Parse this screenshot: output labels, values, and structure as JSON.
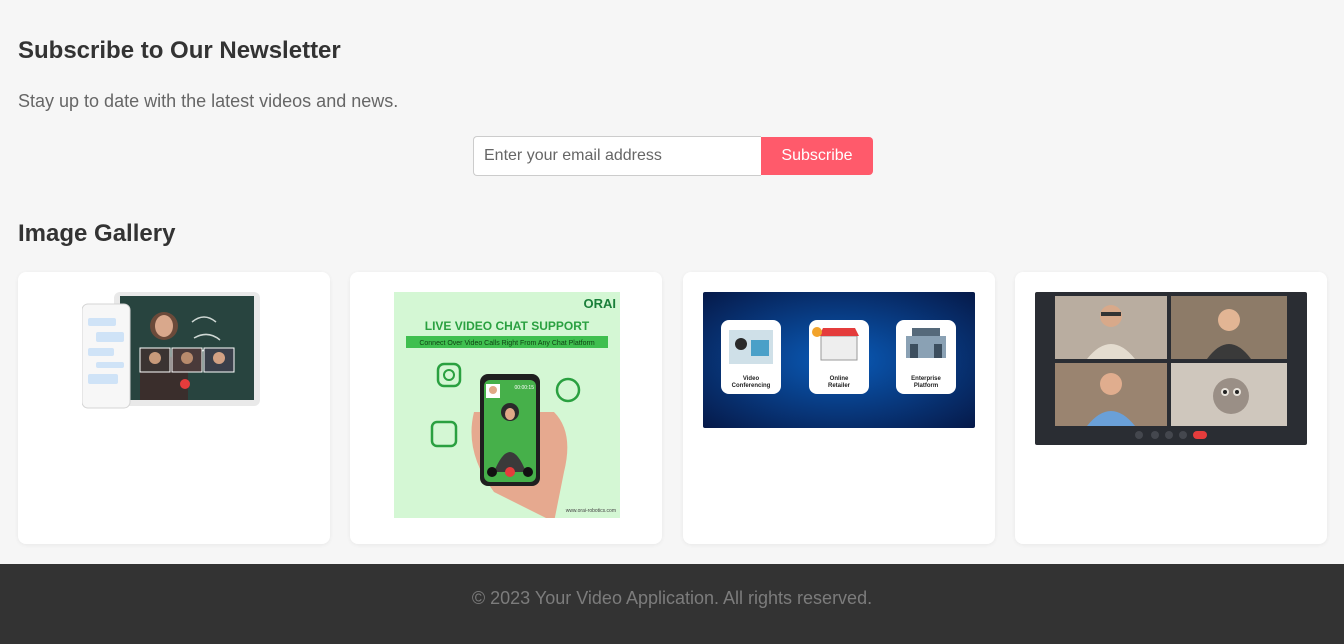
{
  "newsletter": {
    "title": "Subscribe to Our Newsletter",
    "subtitle": "Stay up to date with the latest videos and news.",
    "email_placeholder": "Enter your email address",
    "subscribe_label": "Subscribe"
  },
  "gallery": {
    "title": "Image Gallery",
    "images": [
      {
        "icon": "video-call-app-image"
      },
      {
        "icon": "live-video-chat-support-image",
        "brand": "ORAI",
        "headline": "LIVE VIDEO CHAT SUPPORT",
        "tagline": "Connect Over Video Calls Right From Any Chat Platform",
        "call_time": "00:00:15",
        "website": "www.orai-robotics.com"
      },
      {
        "icon": "video-platform-types-image",
        "items": [
          "Video Conferencing",
          "Online Retailer",
          "Enterprise Platform"
        ]
      },
      {
        "icon": "group-video-call-image"
      }
    ]
  },
  "colors": {
    "accent": "#ff5a6b",
    "footer_bg": "#333333",
    "page_bg": "#f6f6f6"
  },
  "footer": {
    "copyright": "© 2023 Your Video Application. All rights reserved."
  }
}
